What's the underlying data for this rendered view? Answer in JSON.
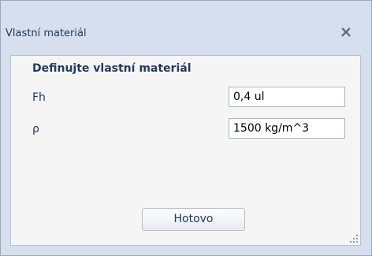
{
  "window": {
    "title": "Vlastní materiál",
    "close_icon": "close-icon"
  },
  "form": {
    "heading": "Definujte vlastní materiál",
    "fields": [
      {
        "label": "Fh",
        "value": "0,4 ul"
      },
      {
        "label": "ρ",
        "value": "1500 kg/m^3"
      }
    ]
  },
  "buttons": {
    "done_label": "Hotovo"
  },
  "colors": {
    "window_bg": "#d5dfed",
    "content_bg": "#f5f5f5",
    "text": "#1e395b"
  }
}
